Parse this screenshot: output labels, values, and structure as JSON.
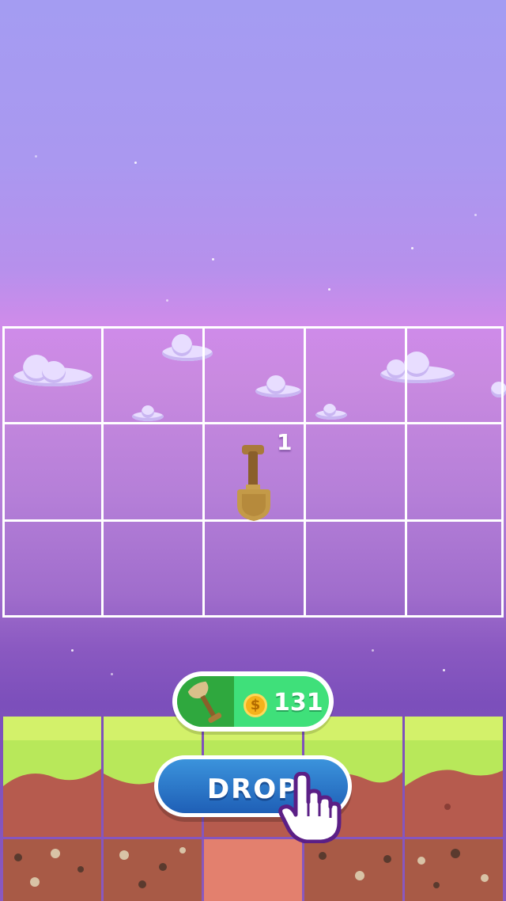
{
  "board": {
    "rows": 3,
    "cols": 5,
    "item": {
      "type": "shovel",
      "row": 2,
      "col": 3,
      "count": "1"
    }
  },
  "hud": {
    "coins": "131",
    "coin_symbol": "$",
    "drop_label": "DROP"
  },
  "colors": {
    "grass": "#b8e85a",
    "dirt": "#b65b4e",
    "button": "#2a78c8",
    "coin_panel": "#3fe07a"
  },
  "icons": [
    "shovel-icon",
    "coin-icon",
    "pointer-hand-icon"
  ]
}
